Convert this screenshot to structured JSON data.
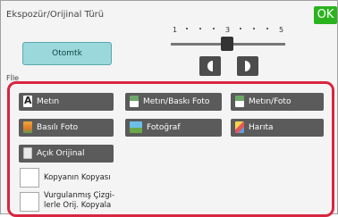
{
  "header": {
    "title": "Ekspozür/Orijinal Türü",
    "ok_label": "OK"
  },
  "exposure": {
    "auto_label": "Otomtk",
    "scale": [
      "1",
      "3",
      "5"
    ],
    "selected_level": 3
  },
  "file_label": "Fİle",
  "original_types": [
    {
      "label": "Metın",
      "icon": "text-icon"
    },
    {
      "label": "Metın/Baskı Foto",
      "icon": "text-printed-photo-icon"
    },
    {
      "label": "Metın/Foto",
      "icon": "text-photo-icon"
    },
    {
      "label": "Basılı Foto",
      "icon": "printed-photo-icon"
    },
    {
      "label": "Fotoğraf",
      "icon": "photo-icon"
    },
    {
      "label": "Harıta",
      "icon": "map-icon"
    },
    {
      "label": "Açık Orijinal",
      "icon": "light-original-icon"
    }
  ],
  "checkboxes": [
    {
      "label": "Kopyanın Kopyası",
      "checked": false
    },
    {
      "label_line1": "Vurgulanmış Çizgi-",
      "label_line2": "lerle Orij. Kopyala",
      "checked": false
    }
  ],
  "colors": {
    "accent_red": "#d9253f",
    "ok_green": "#2bb31f",
    "button_dark": "#5b5b5b",
    "auto_teal": "#9ad8dc"
  }
}
